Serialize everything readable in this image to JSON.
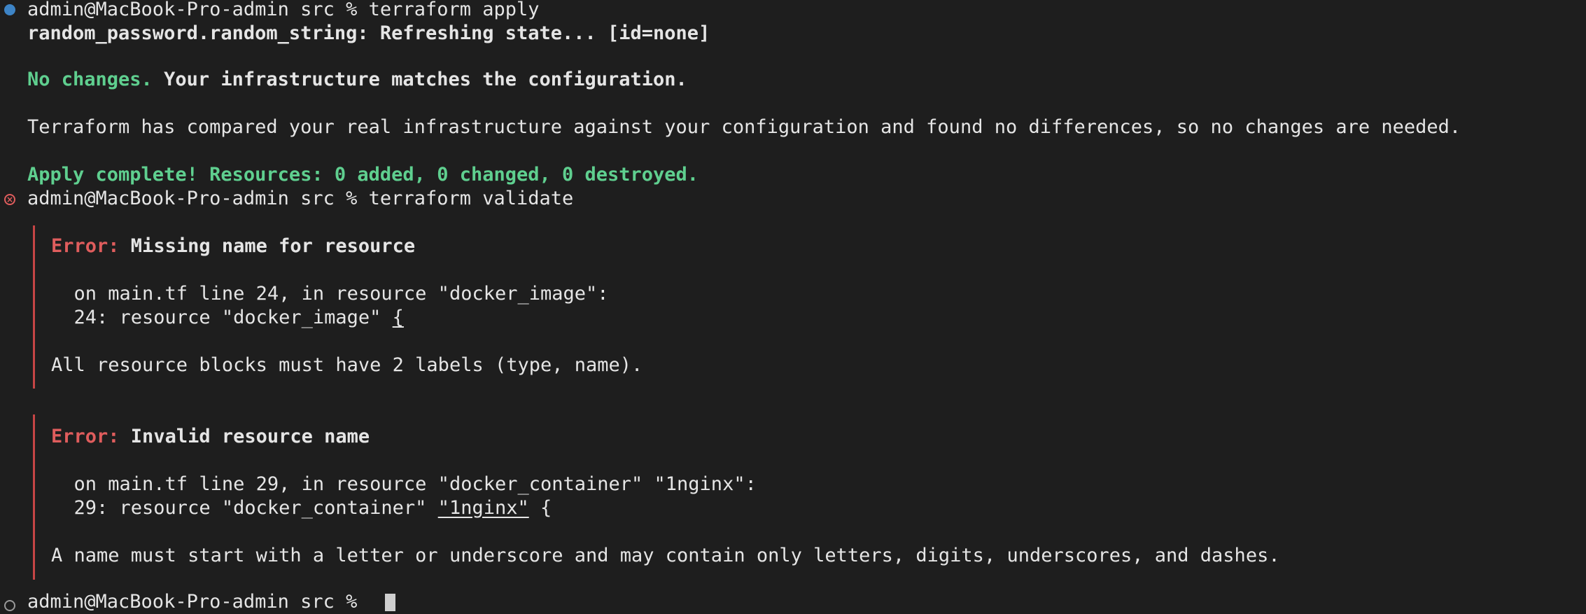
{
  "prompt": "admin@MacBook-Pro-admin src % ",
  "cmd1": "terraform apply",
  "refresh": "random_password.random_string: Refreshing state... [id=none]",
  "no_changes_label": "No changes.",
  "no_changes_msg": " Your infrastructure matches the configuration.",
  "compared": "Terraform has compared your real infrastructure against your configuration and found no differences, so no changes are needed.",
  "apply_complete": "Apply complete! Resources: 0 added, 0 changed, 0 destroyed.",
  "cmd2": "terraform validate",
  "errors": [
    {
      "label": "Error:",
      "title": " Missing name for resource",
      "location": "  on main.tf line 24, in resource \"docker_image\":",
      "code_prefix": "  24: resource \"docker_image\" ",
      "code_marked": "{",
      "code_suffix": "",
      "message": "All resource blocks must have 2 labels (type, name)."
    },
    {
      "label": "Error:",
      "title": " Invalid resource name",
      "location": "  on main.tf line 29, in resource \"docker_container\" \"1nginx\":",
      "code_prefix": "  29: resource \"docker_container\" ",
      "code_marked": "\"1nginx\"",
      "code_suffix": " {",
      "message": "A name must start with a letter or underscore and may contain only letters, digits, underscores, and dashes."
    }
  ],
  "colors": {
    "background": "#1e1e1e",
    "text": "#e5e5e5",
    "success": "#5fcf8f",
    "error": "#e05d5d",
    "status_ok": "#3d84c6"
  },
  "icons": {
    "status_ok": "filled-circle-icon",
    "status_error": "circle-x-icon",
    "status_pending": "hollow-circle-icon"
  }
}
